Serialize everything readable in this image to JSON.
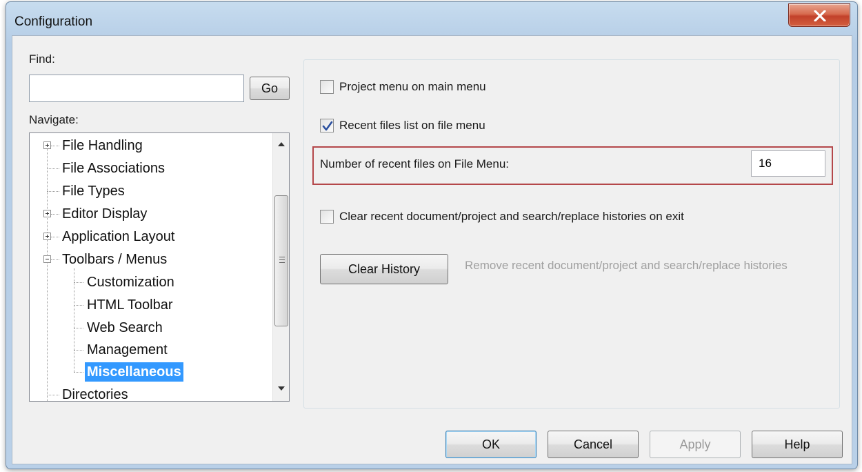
{
  "window": {
    "title": "Configuration",
    "close_glyph": "X"
  },
  "find": {
    "label": "Find:",
    "value": "",
    "go_label": "Go"
  },
  "navigate": {
    "label": "Navigate:",
    "items": [
      {
        "label": "File Handling"
      },
      {
        "label": "File Associations"
      },
      {
        "label": "File Types"
      },
      {
        "label": "Editor Display"
      },
      {
        "label": "Application Layout"
      },
      {
        "label": "Toolbars / Menus"
      },
      {
        "label": "Customization"
      },
      {
        "label": "HTML Toolbar"
      },
      {
        "label": "Web Search"
      },
      {
        "label": "Management"
      },
      {
        "label": "Miscellaneous"
      },
      {
        "label": "Directories"
      }
    ],
    "selected": "Miscellaneous"
  },
  "options": {
    "project_menu": {
      "label": "Project menu on main menu",
      "checked": false
    },
    "recent_files": {
      "label": "Recent files list on file menu",
      "checked": true
    },
    "num_recent": {
      "label": "Number of recent files on File Menu:",
      "value": "16"
    },
    "clear_on_exit": {
      "label": "Clear recent document/project and search/replace histories on exit",
      "checked": false
    },
    "clear_history": {
      "label": "Clear History",
      "description": "Remove recent document/project and search/replace histories"
    }
  },
  "footer": {
    "ok": "OK",
    "cancel": "Cancel",
    "apply": "Apply",
    "help": "Help"
  },
  "colors": {
    "selection": "#3399ff",
    "highlight_border": "#b4474a",
    "close_button": "#c2412a"
  }
}
